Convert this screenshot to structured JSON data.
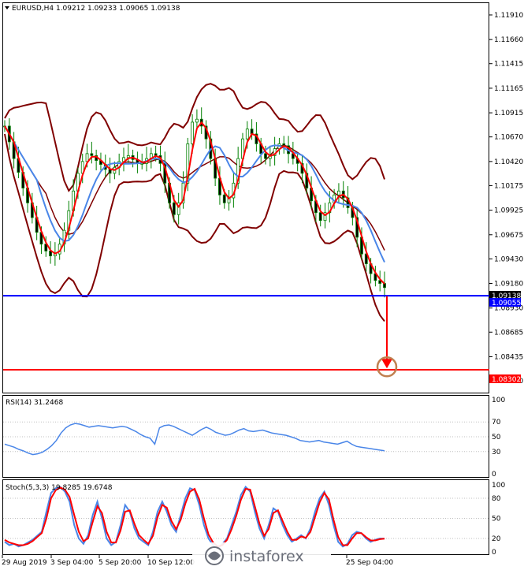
{
  "header": {
    "main": "EURUSD,H4  1.09212 1.09233 1.09065 1.09138",
    "rsi": "RSI(14) 31.2468",
    "stoch": "Stoch(5,3,3) 19.8285 19.6748"
  },
  "price_axis": [
    "1.11910",
    "1.11660",
    "1.11415",
    "1.11165",
    "1.10915",
    "1.10670",
    "1.10420",
    "1.10175",
    "1.09925",
    "1.09675",
    "1.09430",
    "1.09180",
    "1.08930",
    "1.08685",
    "1.08435",
    "1.08190"
  ],
  "rsi_axis": [
    "100",
    "70",
    "50",
    "30",
    "0"
  ],
  "stoch_axis": [
    "100",
    "80",
    "50",
    "20",
    "0"
  ],
  "time_axis": [
    "29 Aug 2019",
    "3 Sep 04:00",
    "5 Sep 20:00",
    "10 Sep 12:00",
    "",
    "",
    "",
    "",
    "25 Sep 04:00"
  ],
  "tags": {
    "last_price": "1.09138",
    "support_level": "1.09055",
    "target_level": "1.08302"
  },
  "watermark": "instaforex",
  "colors": {
    "candle": "#008000",
    "bollinger": "#800000",
    "ma_fast": "#ff0000",
    "ma_slow": "#4a86e8",
    "support_line": "#0000ff",
    "target_line": "#ff0000",
    "rsi_line": "#4a86e8",
    "stoch_main": "#4a86e8",
    "stoch_signal": "#ff0000",
    "target_circle": "#c08050"
  },
  "chart_data": [
    {
      "type": "candlestick",
      "symbol": "EURUSD",
      "timeframe": "H4",
      "last_bar": {
        "open": 1.09212,
        "high": 1.09233,
        "low": 1.09065,
        "close": 1.09138
      },
      "ylim": [
        1.0807,
        1.1203
      ],
      "x_ticks": [
        "29 Aug 2019",
        "3 Sep 04:00",
        "5 Sep 20:00",
        "10 Sep 12:00",
        "25 Sep 04:00"
      ],
      "close_series": [
        1.1078,
        1.1062,
        1.1045,
        1.1031,
        1.1015,
        1.1,
        1.0985,
        1.097,
        1.0958,
        1.0951,
        1.0946,
        1.0948,
        1.0958,
        1.0972,
        1.0992,
        1.1012,
        1.103,
        1.1042,
        1.105,
        1.1048,
        1.1043,
        1.1039,
        1.1034,
        1.103,
        1.1036,
        1.1042,
        1.1046,
        1.1048,
        1.1044,
        1.104,
        1.104,
        1.1045,
        1.105,
        1.1048,
        1.104,
        1.102,
        1.1,
        1.0988,
        1.1,
        1.102,
        1.106,
        1.1082,
        1.1085,
        1.1078,
        1.1065,
        1.1045,
        1.1025,
        1.1008,
        1.1,
        1.1005,
        1.102,
        1.1045,
        1.1065,
        1.1075,
        1.107,
        1.106,
        1.105,
        1.1045,
        1.1048,
        1.1055,
        1.106,
        1.1058,
        1.105,
        1.1045,
        1.104,
        1.103,
        1.1015,
        1.1002,
        1.099,
        1.0982,
        1.099,
        1.1,
        1.1008,
        1.1012,
        1.1005,
        1.0995,
        1.0985,
        1.0965,
        1.0948,
        1.0938,
        1.0928,
        1.0921,
        1.0918,
        1.09138
      ],
      "horizontal_levels": [
        {
          "label": "1.09055",
          "value": 1.09055,
          "color": "blue"
        },
        {
          "label": "1.08302",
          "value": 1.08302,
          "color": "red"
        }
      ],
      "projection": {
        "from": 1.0905,
        "to": 1.083
      }
    },
    {
      "type": "line",
      "name": "RSI(14)",
      "last_value": 31.2468,
      "ylim": [
        0,
        100
      ],
      "levels": [
        70,
        50,
        30
      ],
      "values": [
        40,
        38,
        36,
        33,
        31,
        28,
        26,
        27,
        29,
        33,
        38,
        45,
        55,
        62,
        66,
        68,
        67,
        65,
        63,
        64,
        65,
        64,
        63,
        62,
        63,
        64,
        63,
        60,
        57,
        53,
        50,
        48,
        40,
        62,
        65,
        66,
        64,
        61,
        58,
        55,
        52,
        56,
        60,
        63,
        60,
        56,
        54,
        52,
        53,
        56,
        59,
        61,
        58,
        57,
        58,
        59,
        57,
        55,
        54,
        53,
        52,
        50,
        48,
        45,
        44,
        43,
        44,
        45,
        43,
        42,
        41,
        40,
        42,
        44,
        40,
        37,
        36,
        35,
        34,
        33,
        32,
        31.2
      ]
    },
    {
      "type": "line",
      "name": "Stoch(5,3,3)",
      "main_last": 19.8285,
      "signal_last": 19.6748,
      "ylim": [
        0,
        100
      ],
      "levels": [
        80,
        50,
        20
      ],
      "main": [
        15,
        10,
        12,
        8,
        10,
        14,
        18,
        24,
        30,
        60,
        88,
        95,
        97,
        90,
        75,
        40,
        20,
        12,
        25,
        55,
        75,
        50,
        20,
        10,
        15,
        40,
        70,
        60,
        35,
        20,
        15,
        10,
        30,
        60,
        75,
        60,
        40,
        30,
        55,
        80,
        95,
        92,
        70,
        40,
        20,
        10,
        5,
        12,
        20,
        40,
        60,
        85,
        97,
        90,
        60,
        35,
        20,
        40,
        65,
        60,
        40,
        25,
        15,
        20,
        25,
        20,
        35,
        60,
        80,
        90,
        70,
        40,
        15,
        8,
        12,
        25,
        30,
        28,
        20,
        15,
        18,
        20,
        19.8
      ],
      "signal": [
        18,
        14,
        12,
        10,
        10,
        12,
        16,
        22,
        28,
        50,
        80,
        92,
        96,
        93,
        82,
        55,
        30,
        16,
        20,
        45,
        68,
        58,
        30,
        14,
        14,
        32,
        60,
        62,
        42,
        25,
        18,
        12,
        24,
        52,
        70,
        66,
        46,
        34,
        48,
        72,
        90,
        94,
        78,
        50,
        26,
        14,
        8,
        10,
        18,
        34,
        54,
        78,
        94,
        93,
        68,
        42,
        24,
        34,
        58,
        62,
        46,
        30,
        18,
        18,
        23,
        21,
        30,
        52,
        74,
        88,
        78,
        48,
        22,
        10,
        10,
        20,
        28,
        28,
        22,
        17,
        17,
        19,
        19.7
      ]
    }
  ]
}
